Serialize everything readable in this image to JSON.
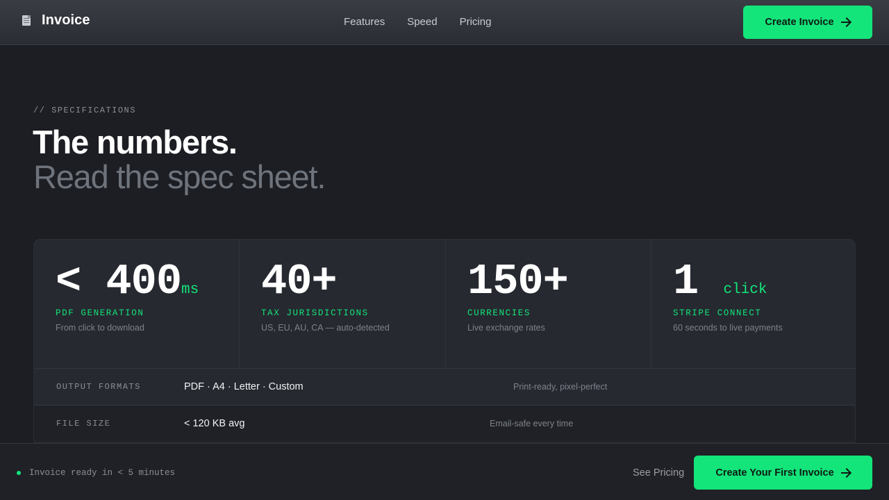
{
  "header": {
    "brand_name": "Invoice",
    "brand_icon": "invoice-document-icon",
    "nav": [
      "Features",
      "Speed",
      "Pricing"
    ],
    "cta_label": "Create Invoice",
    "cta_icon": "arrow-right-icon"
  },
  "section": {
    "eyebrow": "// SPECIFICATIONS",
    "title": "The numbers.",
    "subtitle": "Read the spec sheet."
  },
  "stats": [
    {
      "value": "< 400",
      "unit": "ms",
      "label": "PDF GENERATION",
      "description": "From click to download"
    },
    {
      "value": "40+",
      "unit": "",
      "label": "TAX JURISDICTIONS",
      "description": "US, EU, AU, CA — auto-detected"
    },
    {
      "value": "150+",
      "unit": "",
      "label": "CURRENCIES",
      "description": "Live exchange rates"
    },
    {
      "value": "1",
      "unit": "click",
      "label": "STRIPE CONNECT",
      "description": "60 seconds to live payments"
    }
  ],
  "specs": [
    {
      "key": "OUTPUT FORMATS",
      "value": "PDF · A4 · Letter · Custom",
      "note": "Print-ready, pixel-perfect"
    },
    {
      "key": "FILE SIZE",
      "value": "< 120 KB avg",
      "note": "Email-safe every time"
    }
  ],
  "footer_bar": {
    "status_text": "Invoice ready in < 5 minutes",
    "status_color": "#13e57a",
    "secondary_link": "See Pricing",
    "cta_label": "Create Your First Invoice"
  },
  "colors": {
    "accent": "#13e57a",
    "background": "#1c1e23",
    "card": "#262930"
  }
}
